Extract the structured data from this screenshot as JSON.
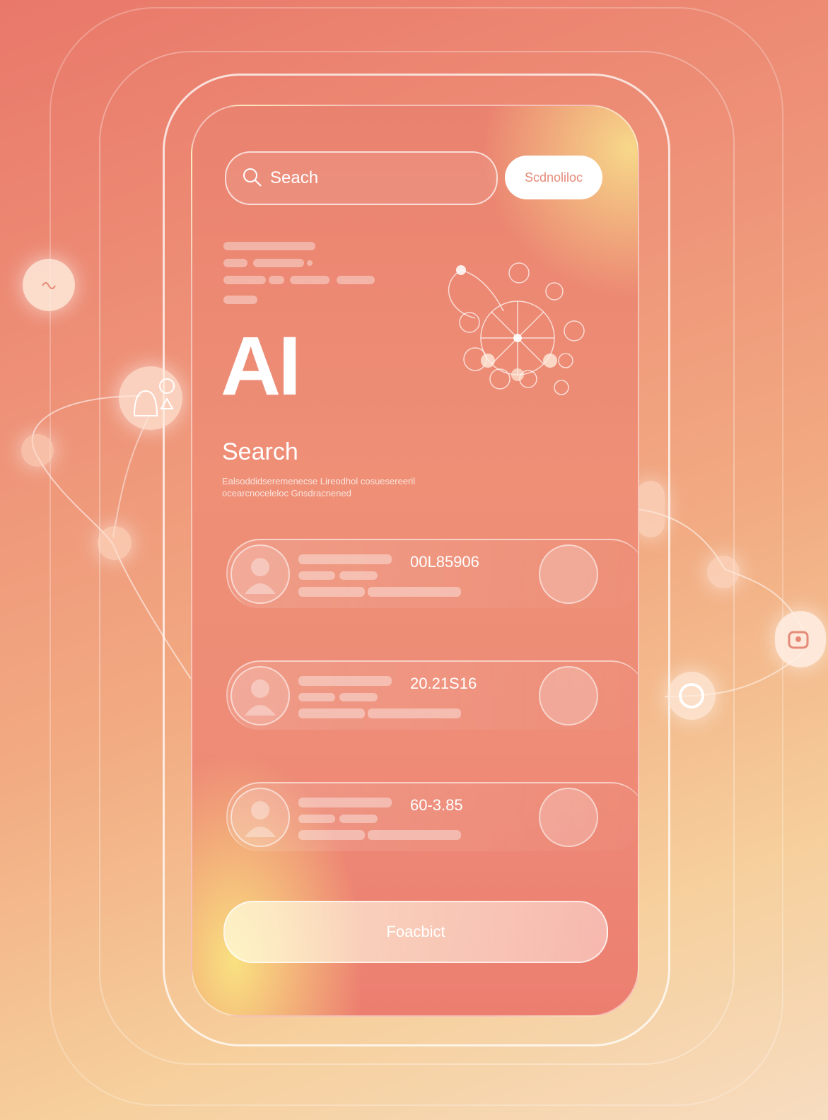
{
  "search": {
    "placeholder": "Seach",
    "button_label": "Scdnoliloc"
  },
  "hero": {
    "title": "AI",
    "subtitle": "Search",
    "description_line1": "Ealsoddidseremenecse Lireodhol cosuesereeril",
    "description_line2": "ocearcnoceleloc Gnsdracnened"
  },
  "results": [
    {
      "value": "00L85906"
    },
    {
      "value": "20.21S16"
    },
    {
      "value": "60-3.85"
    }
  ],
  "footer": {
    "button_label": "Foacbict"
  }
}
